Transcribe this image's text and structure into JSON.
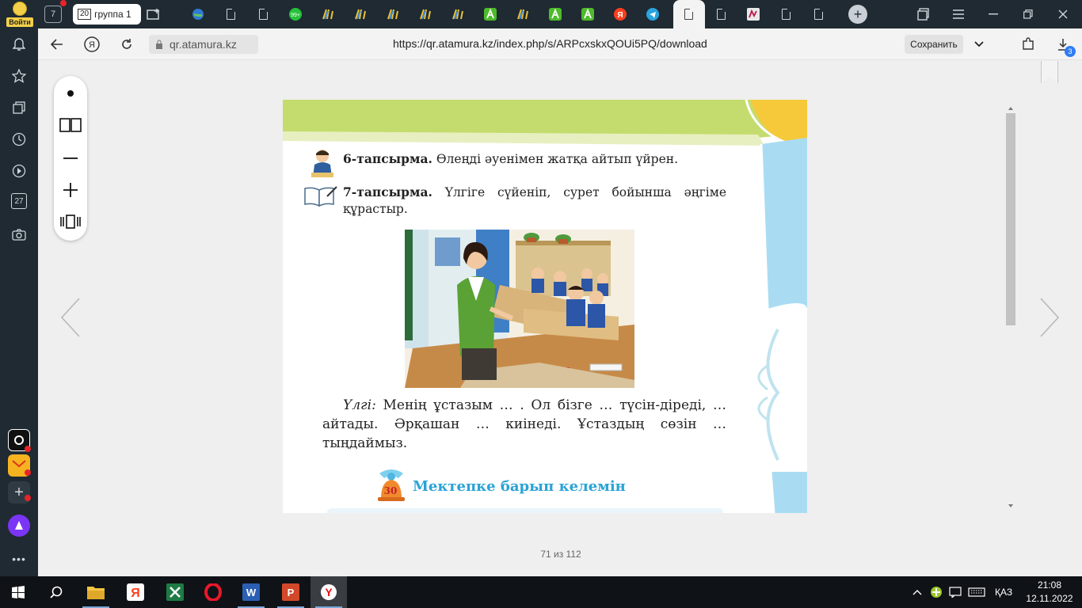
{
  "tabstrip": {
    "login_label": "Войти",
    "group_count": "7",
    "group_tab_count": "20",
    "group_tab_label": "группа 1"
  },
  "address": {
    "domain": "qr.atamura.kz",
    "url": "https://qr.atamura.kz/index.php/s/ARPcxskxQOUi5PQ/download",
    "save_label": "Сохранить",
    "downloads_badge": "3"
  },
  "sidebar": {
    "calendar_day": "27"
  },
  "book": {
    "task6_label": "6-тапсырма.",
    "task6_text": " Өлеңді әуенімен жатқа айтып үйрен.",
    "task7_label": "7-тапсырма.",
    "task7_text": " Үлгіге сүйеніп, сурет бойынша әңгіме құрастыр.",
    "ulgi_label": "Үлгі:",
    "ulgi_text": " Менің ұстазым … . Ол бізге … түсін-діреді, … айтады. Әрқашан … киінеді. Ұстаздың сөзін … тыңдаймыз.",
    "section_number": "30",
    "section_title": "Мектепке барып келемін"
  },
  "viewer": {
    "page_info": "71 из 112"
  },
  "taskbar": {
    "language": "ҚАЗ",
    "time": "21:08",
    "date": "12.11.2022"
  }
}
